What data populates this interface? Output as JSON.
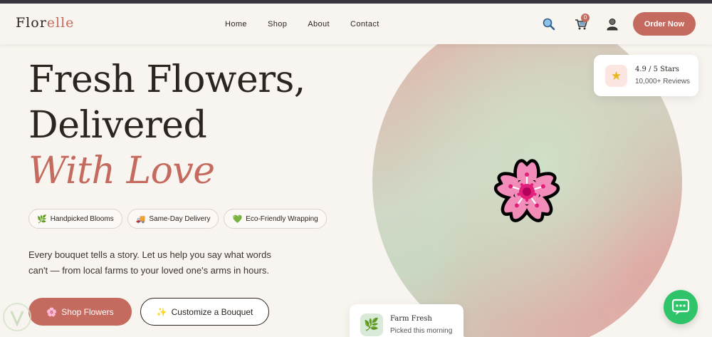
{
  "brand": {
    "name_part1": "Flor",
    "name_part2": "elle"
  },
  "nav": {
    "links": [
      "Home",
      "Shop",
      "About",
      "Contact"
    ],
    "cart_count": "0",
    "order_label": "Order Now"
  },
  "hero": {
    "line1": "Fresh Flowers,",
    "line2": "Delivered",
    "line3": "With Love",
    "features": [
      {
        "icon": "🌿",
        "label": "Handpicked Blooms"
      },
      {
        "icon": "🚚",
        "label": "Same-Day Delivery"
      },
      {
        "icon": "💚",
        "label": "Eco-Friendly Wrapping"
      }
    ],
    "description": "Every bouquet tells a story. Let us help you say what words can't — from local farms to your loved one's arms in hours.",
    "primary_cta": {
      "icon": "🌸",
      "label": "Shop Flowers"
    },
    "secondary_cta": {
      "icon": "✨",
      "label": "Customize a Bouquet"
    }
  },
  "rating_card": {
    "icon": "★",
    "title": "4.9 / 5 Stars",
    "subtitle": "10,000+ Reviews"
  },
  "fresh_card": {
    "icon": "🌿",
    "title": "Farm Fresh",
    "subtitle": "Picked this morning"
  },
  "colors": {
    "accent": "#c46a5e",
    "background": "#f8f4ef",
    "chat": "#2fc46a"
  },
  "icons": [
    "search-icon",
    "cart-icon",
    "user-icon",
    "flower-icon",
    "chat-icon"
  ]
}
